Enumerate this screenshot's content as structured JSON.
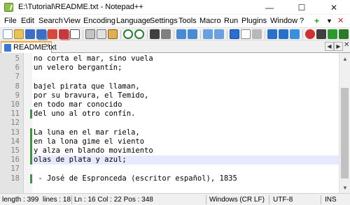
{
  "window": {
    "title": "E:\\Tutorial\\README.txt - Notepad++",
    "minimize_glyph": "—",
    "maximize_glyph": "☐",
    "close_glyph": "✕"
  },
  "menu": {
    "items": [
      "File",
      "Edit",
      "Search",
      "View",
      "Encoding",
      "Language",
      "Settings",
      "Tools",
      "Macro",
      "Run",
      "Plugins",
      "Window",
      "?"
    ],
    "right": [
      "+",
      "▼",
      "✕"
    ]
  },
  "tabs": {
    "active_label": "README.txt",
    "close_glyph": "✕",
    "prev_glyph": "◀",
    "next_glyph": "▶",
    "list_close_glyph": "✕"
  },
  "editor": {
    "current_line": 16,
    "lines": [
      {
        "num": "5",
        "text": "no corta el mar, sino vuela",
        "changed": false
      },
      {
        "num": "6",
        "text": "un velero bergantín;",
        "changed": false
      },
      {
        "num": "7",
        "text": "",
        "changed": false
      },
      {
        "num": "8",
        "text": "bajel pirata que llaman,",
        "changed": false
      },
      {
        "num": "9",
        "text": "por su bravura, el Temido,",
        "changed": false
      },
      {
        "num": "10",
        "text": "en todo mar conocido",
        "changed": false
      },
      {
        "num": "11",
        "text": "del uno al otro confín.",
        "changed": true
      },
      {
        "num": "12",
        "text": "",
        "changed": false
      },
      {
        "num": "13",
        "text": "La luna en el mar riela,",
        "changed": true
      },
      {
        "num": "14",
        "text": "en la lona gime el viento",
        "changed": true
      },
      {
        "num": "15",
        "text": "y alza en blando movimiento",
        "changed": true
      },
      {
        "num": "16",
        "text": "olas de plata y azul;",
        "changed": true
      },
      {
        "num": "17",
        "text": "",
        "changed": false
      },
      {
        "num": "18",
        "text": " - José de Espronceda (escritor español), 1835",
        "changed": true
      }
    ],
    "scroll_up_glyph": "▲",
    "scroll_down_glyph": "▼"
  },
  "status": {
    "length": "length : 399",
    "lines": "lines : 18",
    "position": "Ln : 16   Col : 22   Pos : 348",
    "eol": "Windows (CR LF)",
    "encoding": "UTF-8",
    "mode": "INS"
  },
  "colors": {
    "accent_tab": "#f5a623",
    "change_marker": "#2aa12a",
    "current_line": "#e8e8ff"
  }
}
